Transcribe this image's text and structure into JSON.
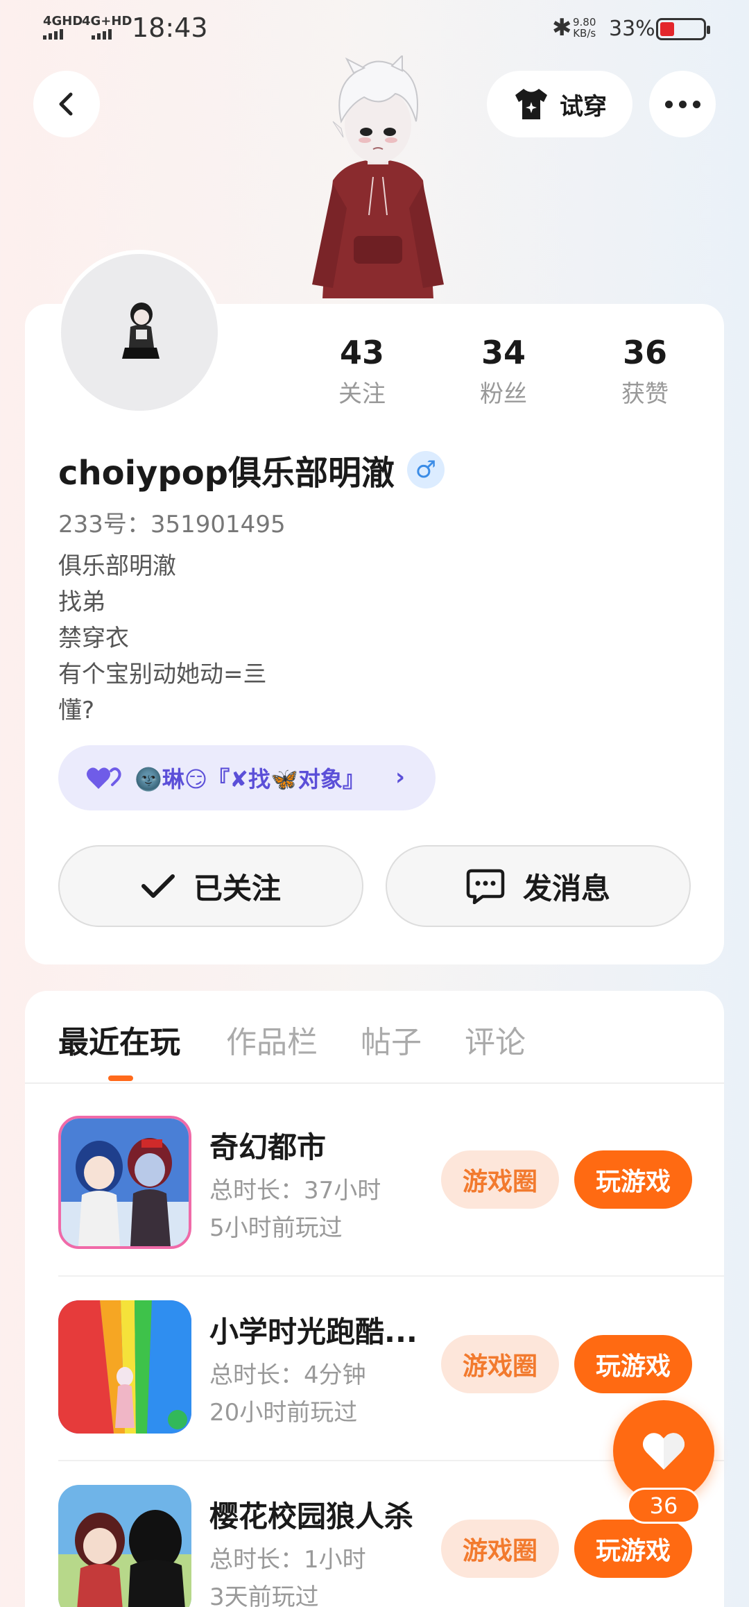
{
  "status_bar": {
    "network1": "4GHD",
    "network2": "4G+HD",
    "time": "18:43",
    "speed_value": "9.80",
    "speed_unit": "KB/s",
    "battery": "33%"
  },
  "header": {
    "try_on_label": "试穿"
  },
  "profile": {
    "stats": [
      {
        "value": "43",
        "label": "关注"
      },
      {
        "value": "34",
        "label": "粉丝"
      },
      {
        "value": "36",
        "label": "获赞"
      }
    ],
    "username": "choiypop俱乐部明澈",
    "gender_symbol": "♂",
    "uid": "233号：351901495",
    "bio_lines": [
      "俱乐部明澈",
      "找弟",
      "禁穿衣",
      "有个宝别动她动=亖",
      "懂?"
    ],
    "relation_text": "🌚琳😏『✘找🦋对象』",
    "follow_label": "已关注",
    "message_label": "发消息"
  },
  "tabs": [
    "最近在玩",
    "作品栏",
    "帖子",
    "评论"
  ],
  "games": [
    {
      "title": "奇幻都市",
      "duration": "总时长：37小时",
      "last_played": "5小时前玩过",
      "circle_label": "游戏圈",
      "play_label": "玩游戏"
    },
    {
      "title": "小学时光跑酷...",
      "duration": "总时长：4分钟",
      "last_played": "20小时前玩过",
      "circle_label": "游戏圈",
      "play_label": "玩游戏"
    },
    {
      "title": "樱花校园狼人杀",
      "duration": "总时长：1小时",
      "last_played": "3天前玩过",
      "circle_label": "游戏圈",
      "play_label": "玩游戏"
    }
  ],
  "like_fab": {
    "count": "36"
  },
  "colors": {
    "accent": "#ff6a12",
    "accent_light": "#fde6da",
    "relation_bg": "#ebebfc",
    "relation_text": "#5b4fd8"
  }
}
